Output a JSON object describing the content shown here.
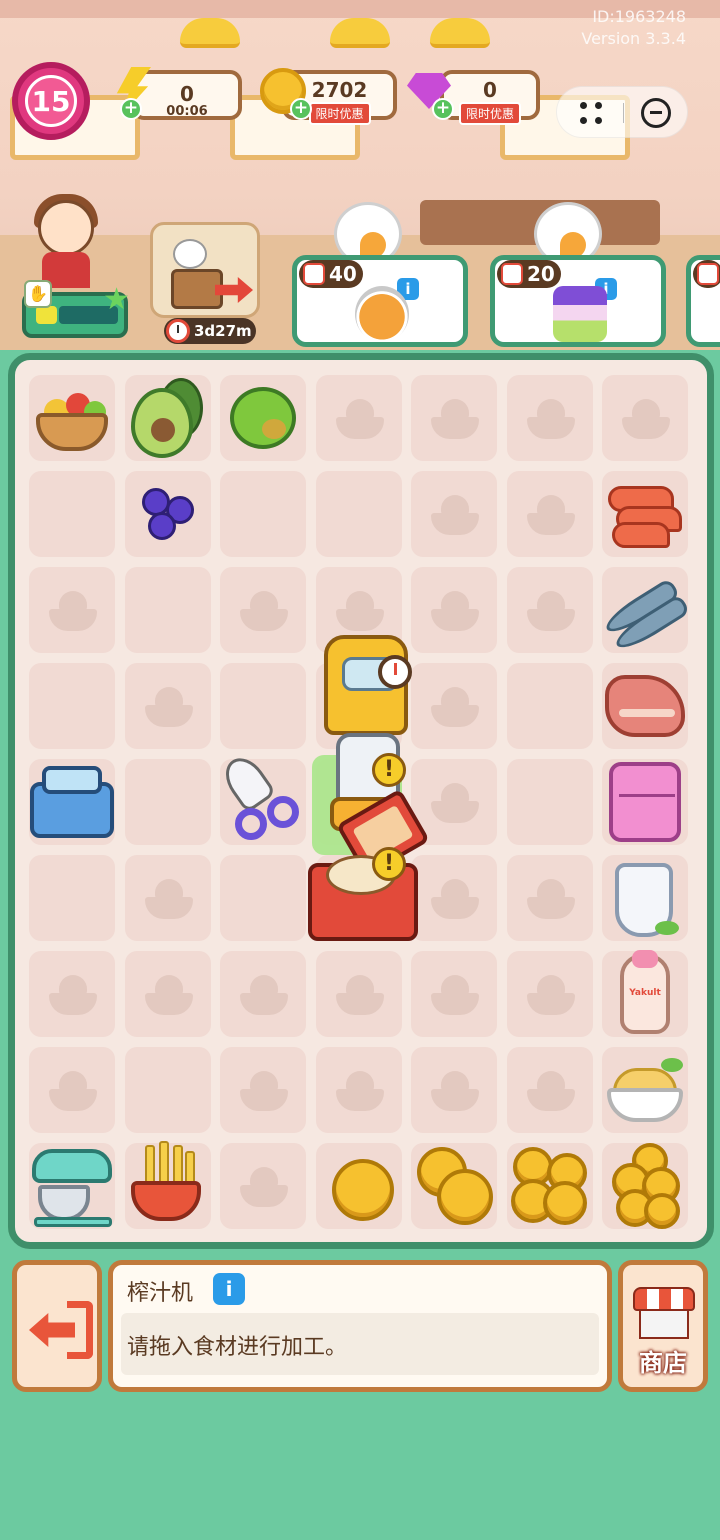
{
  "meta": {
    "id_text": "ID:1963248",
    "version_text": "Version 3.3.4"
  },
  "hud": {
    "level": "15",
    "energy": {
      "value": "0",
      "timer": "00:06",
      "icon": "lightning-icon"
    },
    "coins": {
      "value": "2702",
      "tag": "限时优惠",
      "icon": "coin-icon"
    },
    "gems": {
      "value": "0",
      "tag": "限时优惠",
      "icon": "gem-icon"
    }
  },
  "chef": {
    "progress_fraction": 0.25
  },
  "event": {
    "timer": "3d27m"
  },
  "orders": [
    {
      "reward": "40",
      "dish_icon": "orange-juice-icon"
    },
    {
      "reward": "20",
      "dish_icon": "blueberry-cake-icon"
    }
  ],
  "board_items": {
    "row1": [
      "fruit-basket-icon",
      "avocado-icon",
      "apple-icon"
    ],
    "row2": [
      "blueberries-icon",
      "shrimp-icon"
    ],
    "right_column": [
      "fish-icon",
      "meat-icon",
      "fridge-icon",
      "milk-jug-icon",
      "yakult-icon",
      "pasta-bowl-icon"
    ],
    "left_column": [
      "ice-maker-icon",
      "stand-mixer-icon",
      "fries-icon"
    ],
    "middle": [
      "scissors-icon",
      "juicer-machine-icon",
      "blender-icon",
      "oven-icon"
    ],
    "coins": [
      "coin-1-icon",
      "coin-2-icon",
      "coin-3-icon",
      "coin-4-icon"
    ]
  },
  "yakult_label": "Yakult",
  "selected": {
    "name": "榨汁机",
    "description": "请拖入食材进行加工。"
  },
  "buttons": {
    "exit_icon": "exit-icon",
    "shop_label": "商店"
  },
  "colors": {
    "board_border": "#3f8f6a",
    "background": "#6ccaa0",
    "panel_border": "#c07a3c"
  }
}
